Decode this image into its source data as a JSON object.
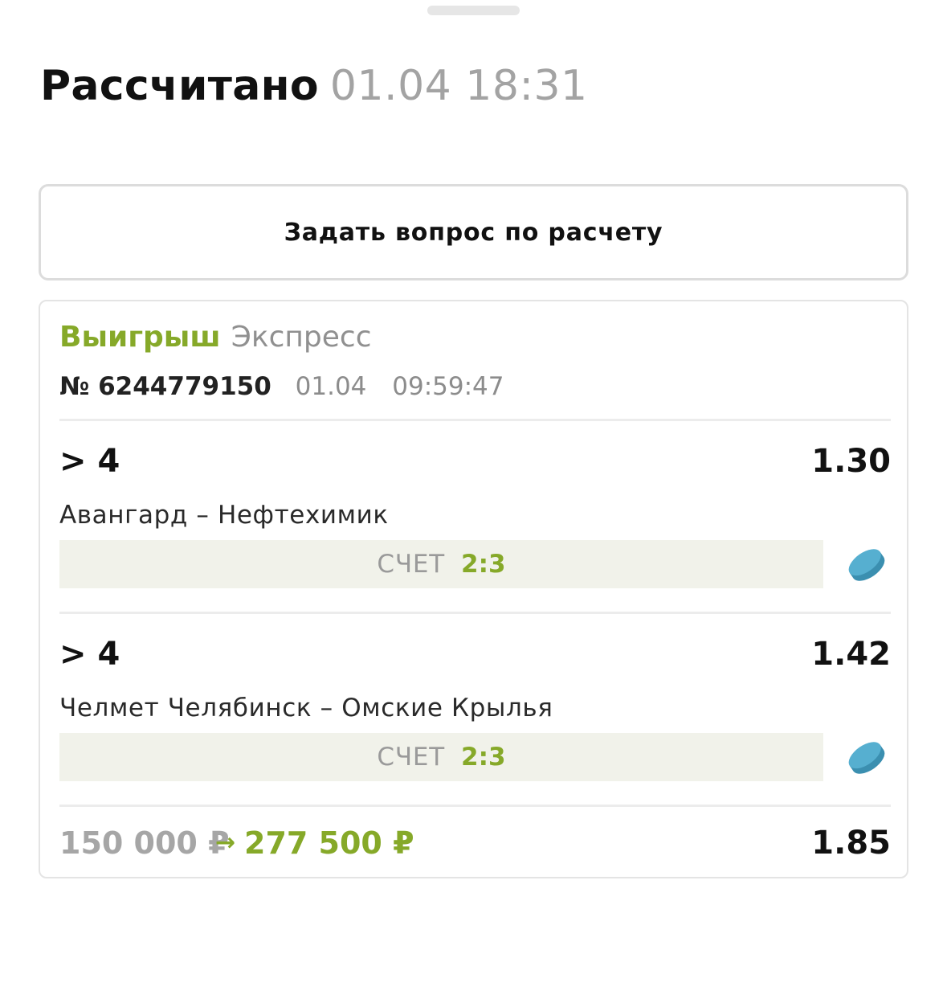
{
  "header": {
    "title": "Рассчитано",
    "settled_at": "01.04 18:31"
  },
  "ask_button": {
    "label": "Задать вопрос по расчету"
  },
  "bet": {
    "result": "Выигрыш",
    "type": "Экспресс",
    "number": "№ 6244779150",
    "date": "01.04",
    "time": "09:59:47",
    "selections": [
      {
        "outcome": "> 4",
        "odds": "1.30",
        "match": "Авангард – Нефтехимик",
        "score_label": "СЧЕТ",
        "score": "2:3",
        "sport_icon": "hockey-puck-icon"
      },
      {
        "outcome": "> 4",
        "odds": "1.42",
        "match": "Челмет Челябинск – Омские Крылья",
        "score_label": "СЧЕТ",
        "score": "2:3",
        "sport_icon": "hockey-puck-icon"
      }
    ],
    "stake": "150 000 ₽",
    "arrow": "→",
    "payout": "277 500 ₽",
    "total_odds": "1.85"
  },
  "colors": {
    "accent_green": "#86a929",
    "puck_blue": "#4aa3c4",
    "score_bg": "#f1f2ea",
    "muted_text": "#a3a3a3"
  }
}
